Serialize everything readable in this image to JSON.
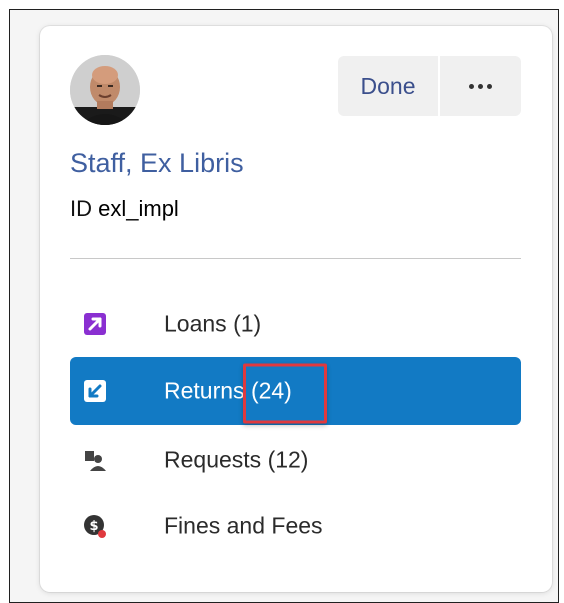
{
  "header": {
    "done_label": "Done"
  },
  "user": {
    "name": "Staff, Ex Libris",
    "id_label": "ID",
    "id_value": "exl_impl"
  },
  "nav": {
    "items": [
      {
        "label": "Loans",
        "count": "(1)",
        "icon": "loans-icon",
        "active": false
      },
      {
        "label": "Returns",
        "count": "(24)",
        "icon": "returns-icon",
        "active": true
      },
      {
        "label": "Requests",
        "count": "(12)",
        "icon": "requests-icon",
        "active": false
      },
      {
        "label": "Fines and Fees",
        "count": "",
        "icon": "fines-icon",
        "active": false
      }
    ]
  },
  "colors": {
    "active_bg": "#127ac4",
    "link": "#3f5fa0",
    "loans_icon": "#8a2fd1",
    "highlight_box": "#e0393e",
    "alert_dot": "#e0393e"
  }
}
